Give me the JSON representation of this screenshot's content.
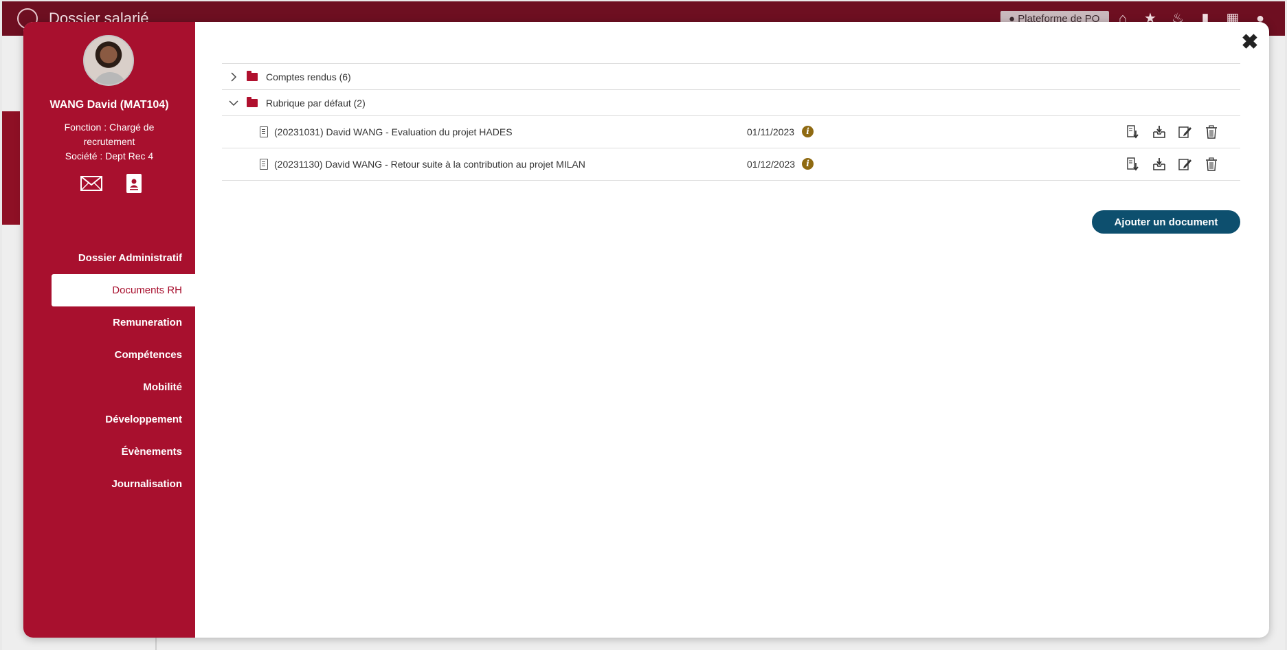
{
  "app": {
    "title": "Dossier salarié",
    "location_label": "Plateforme de PO",
    "top_icons": [
      "home-icon",
      "star-icon",
      "bell-icon",
      "book-icon",
      "apps-grid-icon",
      "user-circle-icon"
    ]
  },
  "employee": {
    "name": "WANG David (MAT104)",
    "fonction": "Fonction : Chargé de recrutement",
    "societe": "Société : Dept Rec 4"
  },
  "nav": {
    "items": [
      {
        "label": "Dossier Administratif",
        "active": false
      },
      {
        "label": "Documents RH",
        "active": true
      },
      {
        "label": "Remuneration",
        "active": false
      },
      {
        "label": "Compétences",
        "active": false
      },
      {
        "label": "Mobilité",
        "active": false
      },
      {
        "label": "Développement",
        "active": false
      },
      {
        "label": "Évènements",
        "active": false
      },
      {
        "label": "Journalisation",
        "active": false
      }
    ]
  },
  "tree": {
    "folders": [
      {
        "label": "Comptes rendus (6)",
        "expanded": false
      },
      {
        "label": "Rubrique par défaut (2)",
        "expanded": true
      }
    ],
    "documents": [
      {
        "title": "(20231031) David WANG - Evaluation du projet HADES",
        "date": "01/11/2023"
      },
      {
        "title": "(20231130) David WANG - Retour suite à la contribution au projet MILAN",
        "date": "01/12/2023"
      }
    ]
  },
  "actions": {
    "add_document": "Ajouter un document",
    "row_actions": [
      "download-icon",
      "archive-icon",
      "edit-icon",
      "trash-icon"
    ]
  },
  "colors": {
    "sidebar": "#a8102e",
    "app_bar": "#6e0f21",
    "primary_button": "#0d4f6e",
    "info_icon": "#8f6a12"
  }
}
